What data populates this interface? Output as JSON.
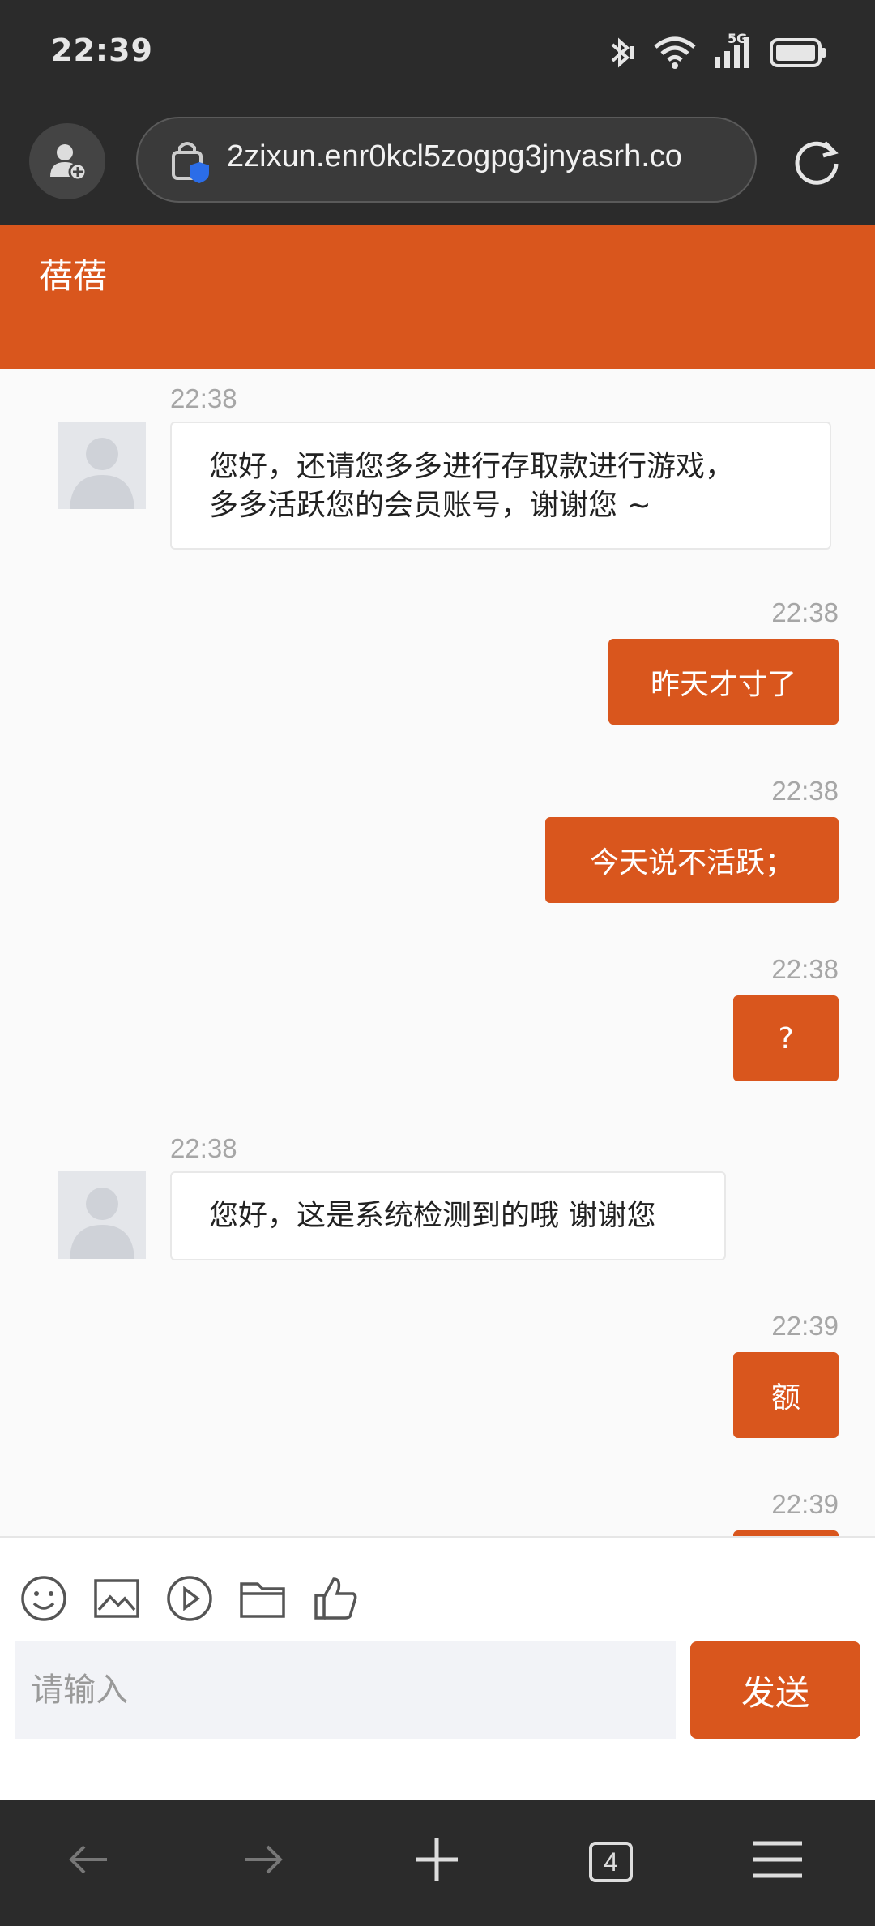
{
  "status_bar": {
    "time": "22:39",
    "network": "5G",
    "icons": [
      "bluetooth-icon",
      "wifi-icon",
      "signal-icon",
      "battery-icon"
    ]
  },
  "browser": {
    "url": "2zixun.enr0kcl5zogpg3jnyasrh.co",
    "tab_count": "4"
  },
  "chat": {
    "title": "蓓蓓",
    "messages": [
      {
        "side": "in",
        "time": "22:38",
        "text_lines": [
          "您好，还请您多多进行存取款进行游戏，",
          "多多活跃您的会员账号，谢谢您 ~"
        ]
      },
      {
        "side": "out",
        "time": "22:38",
        "text": "昨天才寸了"
      },
      {
        "side": "out",
        "time": "22:38",
        "text": "今天说不活跃；"
      },
      {
        "side": "out",
        "time": "22:38",
        "text": "?"
      },
      {
        "side": "in",
        "time": "22:38",
        "text": "您好，这是系统检测到的哦 谢谢您"
      },
      {
        "side": "out",
        "time": "22:39",
        "text": "额"
      },
      {
        "side": "out",
        "time": "22:39",
        "text": ""
      }
    ]
  },
  "composer": {
    "placeholder": "请输入",
    "send_label": "发送",
    "tools": [
      "emoji-icon",
      "image-icon",
      "video-icon",
      "folder-icon",
      "thumbs-up-icon"
    ]
  },
  "colors": {
    "accent": "#d9561d",
    "system_bar": "#2b2b2b"
  }
}
